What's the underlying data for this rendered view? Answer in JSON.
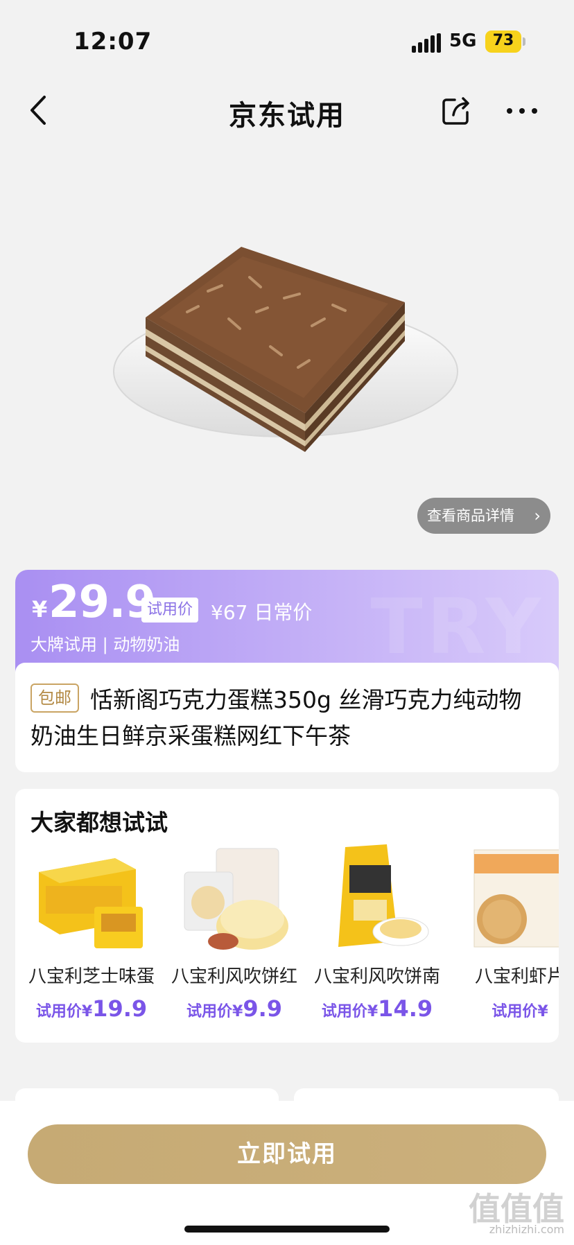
{
  "status_bar": {
    "time": "12:07",
    "network": "5G",
    "battery": "73"
  },
  "nav": {
    "title": "京东试用"
  },
  "product": {
    "detail_button": "查看商品详情",
    "currency": "¥",
    "price": "29.9",
    "trial_badge": "试用价",
    "regular_price": "¥67 日常价",
    "tags": "大牌试用 | 动物奶油",
    "watermark": "TRY",
    "free_shipping": "包邮",
    "title": "恬新阁巧克力蛋糕350g 丝滑巧克力纯动物奶油生日鲜京采蛋糕网红下午茶"
  },
  "recommend": {
    "title": "大家都想试试",
    "items": [
      {
        "name": "八宝利芝士味蛋",
        "price_prefix": "试用价¥",
        "price": "19.9"
      },
      {
        "name": "八宝利风吹饼红",
        "price_prefix": "试用价¥",
        "price": "9.9"
      },
      {
        "name": "八宝利风吹饼南",
        "price_prefix": "试用价¥",
        "price": "14.9"
      },
      {
        "name": "八宝利虾片",
        "price_prefix": "试用价¥",
        "price": ""
      }
    ]
  },
  "bottom": {
    "cta": "立即试用"
  },
  "watermark": {
    "text": "值值值",
    "url": "zhizhizhi.com"
  },
  "colors": {
    "accent_purple": "#a98ff2",
    "gold": "#c6aa74",
    "price_purple": "#7a55e8"
  }
}
